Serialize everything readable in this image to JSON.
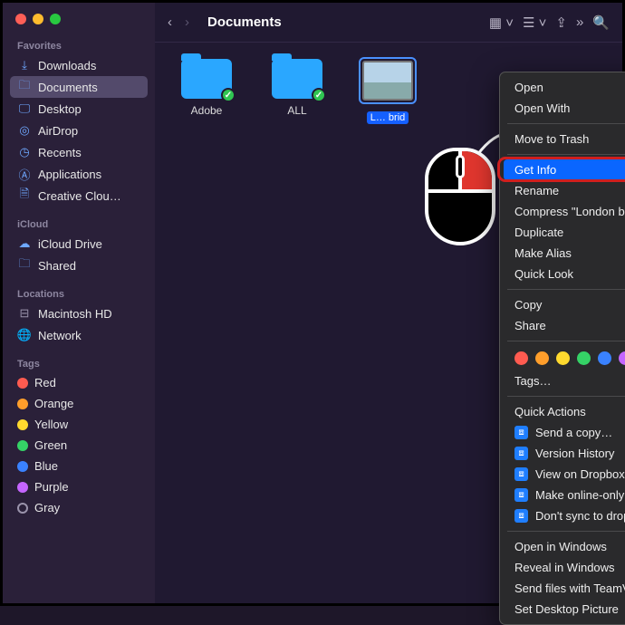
{
  "toolbar": {
    "title": "Documents"
  },
  "sidebar": {
    "favorites_head": "Favorites",
    "favorites": [
      {
        "icon": "download-icon",
        "label": "Downloads"
      },
      {
        "icon": "folder-icon",
        "label": "Documents",
        "selected": true
      },
      {
        "icon": "desktop-icon",
        "label": "Desktop"
      },
      {
        "icon": "airdrop-icon",
        "label": "AirDrop"
      },
      {
        "icon": "clock-icon",
        "label": "Recents"
      },
      {
        "icon": "apps-icon",
        "label": "Applications"
      },
      {
        "icon": "file-icon",
        "label": "Creative Clou…"
      }
    ],
    "icloud_head": "iCloud",
    "icloud": [
      {
        "icon": "cloud-icon",
        "label": "iCloud Drive"
      },
      {
        "icon": "shared-icon",
        "label": "Shared"
      }
    ],
    "locations_head": "Locations",
    "locations": [
      {
        "icon": "disk-icon",
        "label": "Macintosh HD"
      },
      {
        "icon": "globe-icon",
        "label": "Network"
      }
    ],
    "tags_head": "Tags",
    "tags": [
      {
        "color": "#ff5b50",
        "label": "Red"
      },
      {
        "color": "#ff9e2b",
        "label": "Orange"
      },
      {
        "color": "#ffd92e",
        "label": "Yellow"
      },
      {
        "color": "#35d266",
        "label": "Green"
      },
      {
        "color": "#3a82ff",
        "label": "Blue"
      },
      {
        "color": "#c565ff",
        "label": "Purple"
      },
      {
        "color": "#9a93ab",
        "label": "Gray",
        "empty": true
      }
    ]
  },
  "files": [
    {
      "name": "Adobe",
      "type": "folder",
      "synced": true
    },
    {
      "name": "ALL",
      "type": "folder",
      "synced": true
    },
    {
      "name_visible": "L…\nbrid",
      "type": "image",
      "selected": true
    }
  ],
  "context_menu": {
    "groups": [
      [
        {
          "label": "Open"
        },
        {
          "label": "Open With",
          "submenu": true
        }
      ],
      [
        {
          "label": "Move to Trash"
        }
      ],
      [
        {
          "label": "Get Info",
          "highlighted": true
        },
        {
          "label": "Rename"
        },
        {
          "label": "Compress \"London bridge.jpeg\""
        },
        {
          "label": "Duplicate"
        },
        {
          "label": "Make Alias"
        },
        {
          "label": "Quick Look"
        }
      ],
      [
        {
          "label": "Copy"
        },
        {
          "label": "Share",
          "submenu": true
        }
      ]
    ],
    "tag_colors": [
      "#ff5b50",
      "#ff9e2b",
      "#ffd92e",
      "#35d266",
      "#3a82ff",
      "#c565ff",
      "#8e8e92"
    ],
    "tags_label": "Tags…",
    "quick_actions_label": "Quick Actions",
    "dropbox_actions": [
      "Send a copy…",
      "Version History",
      "View on Dropbox.com",
      "Make online-only",
      "Don't sync to dropbox.com"
    ],
    "bottom_group": [
      "Open in Windows",
      "Reveal in Windows",
      "Send files with TeamViewer",
      "Set Desktop Picture"
    ]
  }
}
